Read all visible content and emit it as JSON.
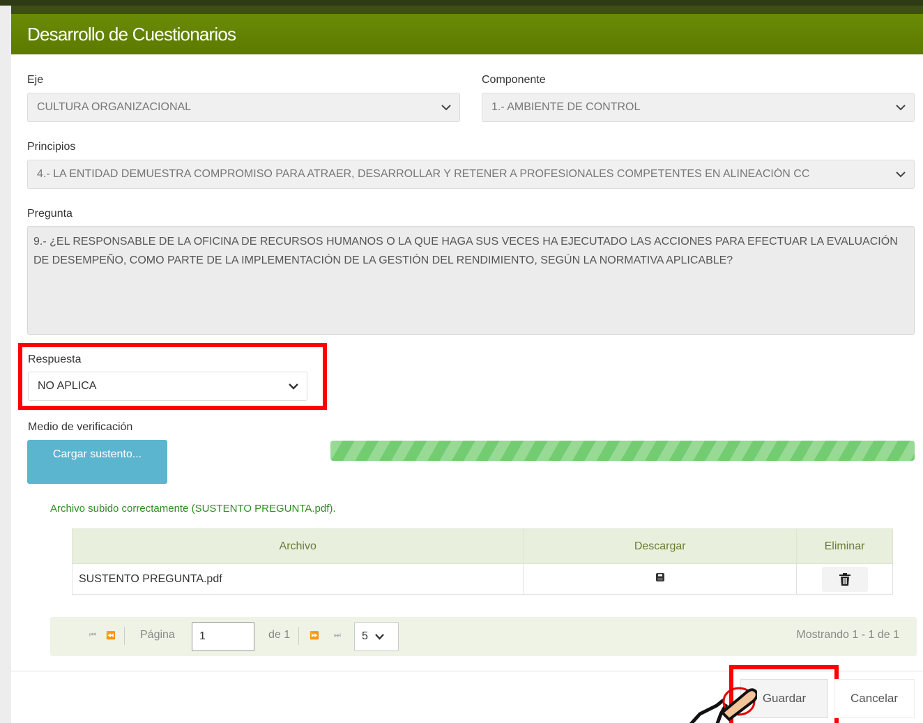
{
  "modal": {
    "title": "Desarrollo de Cuestionarios"
  },
  "eje": {
    "label": "Eje",
    "value": "CULTURA ORGANIZACIONAL"
  },
  "componente": {
    "label": "Componente",
    "value": "1.- AMBIENTE DE CONTROL"
  },
  "principios": {
    "label": "Principios",
    "value": "4.- LA ENTIDAD DEMUESTRA COMPROMISO PARA ATRAER, DESARROLLAR Y RETENER A PROFESIONALES COMPETENTES EN ALINEACIÓN CC"
  },
  "pregunta": {
    "label": "Pregunta",
    "value": "9.- ¿EL RESPONSABLE DE LA OFICINA DE RECURSOS HUMANOS O LA QUE HAGA SUS VECES HA EJECUTADO LAS ACCIONES PARA EFECTUAR LA EVALUACIÓN DE DESEMPEÑO, COMO PARTE DE LA IMPLEMENTACIÓN DE LA GESTIÓN DEL RENDIMIENTO, SEGÚN LA NORMATIVA APLICABLE?"
  },
  "respuesta": {
    "label": "Respuesta",
    "value": "NO APLICA"
  },
  "medio": {
    "label": "Medio de verificación",
    "upload_button": "Cargar sustento...",
    "progress_fraction": 1.0,
    "success_message": "Archivo subido correctamente (SUSTENTO PREGUNTA.pdf)."
  },
  "files_table": {
    "headers": [
      "Archivo",
      "Descargar",
      "Eliminar"
    ],
    "rows": [
      {
        "archivo": "SUSTENTO PREGUNTA.pdf",
        "descargar_icon": "save-icon",
        "eliminar_icon": "trash-icon"
      }
    ]
  },
  "pager": {
    "page_label": "Página",
    "page_value": "1",
    "of_label": "de 1",
    "page_size": "5",
    "showing": "Mostrando 1 - 1 de 1"
  },
  "footer": {
    "save_label": "Guardar",
    "cancel_label": "Cancelar"
  },
  "colors": {
    "header_green": "#5c7a00",
    "highlight_red": "#ff0000",
    "upload_blue": "#5bb5cf",
    "progress_green": "#74cc72",
    "success_green": "#2e8b22"
  }
}
